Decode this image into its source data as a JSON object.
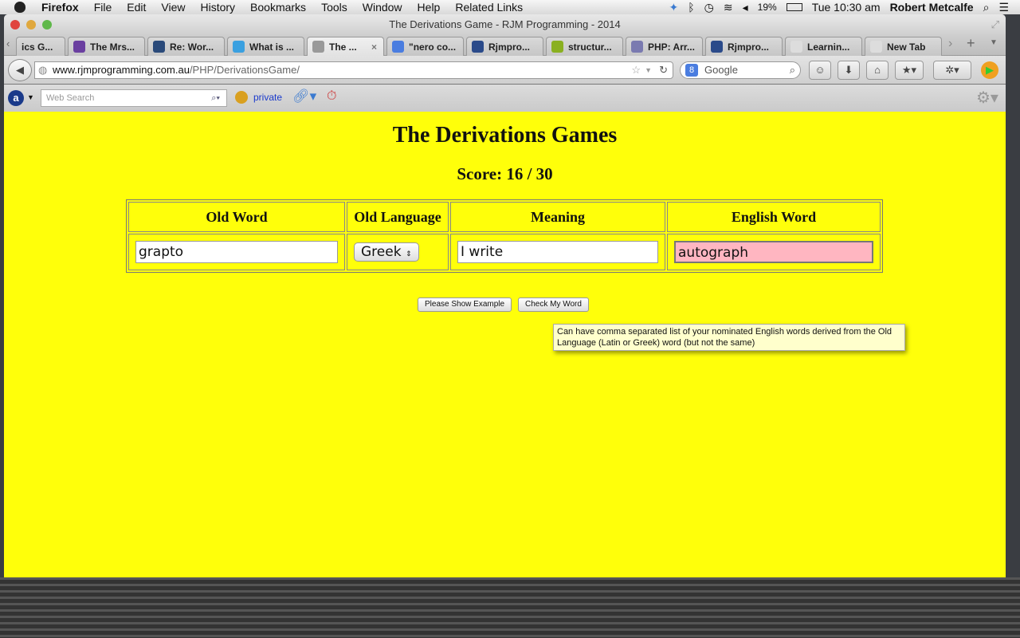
{
  "menubar": {
    "app": "Firefox",
    "items": [
      "File",
      "Edit",
      "View",
      "History",
      "Bookmarks",
      "Tools",
      "Window",
      "Help",
      "Related Links"
    ],
    "battery": "19%",
    "clock": "Tue 10:30 am",
    "user": "Robert Metcalfe"
  },
  "window": {
    "title": "The Derivations Game - RJM Programming - 2014"
  },
  "tabs": [
    {
      "label": "ics G...",
      "color": "#888"
    },
    {
      "label": "The Mrs...",
      "color": "#6a3fa0"
    },
    {
      "label": "Re: Wor...",
      "color": "#2a4a7a"
    },
    {
      "label": "What is ...",
      "color": "#3aa0e0"
    },
    {
      "label": "The ...",
      "color": "#999",
      "active": true
    },
    {
      "label": "\"nero co...",
      "color": "#4a7de0"
    },
    {
      "label": "Rjmpro...",
      "color": "#2a4a8a"
    },
    {
      "label": "structur...",
      "color": "#8ab020"
    },
    {
      "label": "PHP: Arr...",
      "color": "#7a7ab0"
    },
    {
      "label": "Rjmpro...",
      "color": "#2a4a8a"
    },
    {
      "label": "Learnin...",
      "color": "#ddd"
    },
    {
      "label": "New Tab",
      "color": "#ddd"
    }
  ],
  "nav": {
    "url_host": "www.rjmprogramming.com.au",
    "url_path": "/PHP/DerivationsGame/",
    "search_placeholder": "Google"
  },
  "toolbar2": {
    "websearch_placeholder": "Web Search",
    "private_label": "private"
  },
  "page": {
    "title": "The Derivations Games",
    "score": "Score: 16 / 30",
    "headers": [
      "Old Word",
      "Old Language",
      "Meaning",
      "English Word"
    ],
    "old_word": "grapto",
    "old_language": "Greek",
    "meaning": "I write",
    "english_word": "autograph",
    "english_word_bg": "#ffb6c1",
    "show_example": "Please Show Example",
    "check_word": "Check My Word",
    "tooltip": "Can have comma separated list of your nominated English words derived from the Old Language (Latin or Greek) word (but not the same)",
    "background": "#ffff0a"
  }
}
